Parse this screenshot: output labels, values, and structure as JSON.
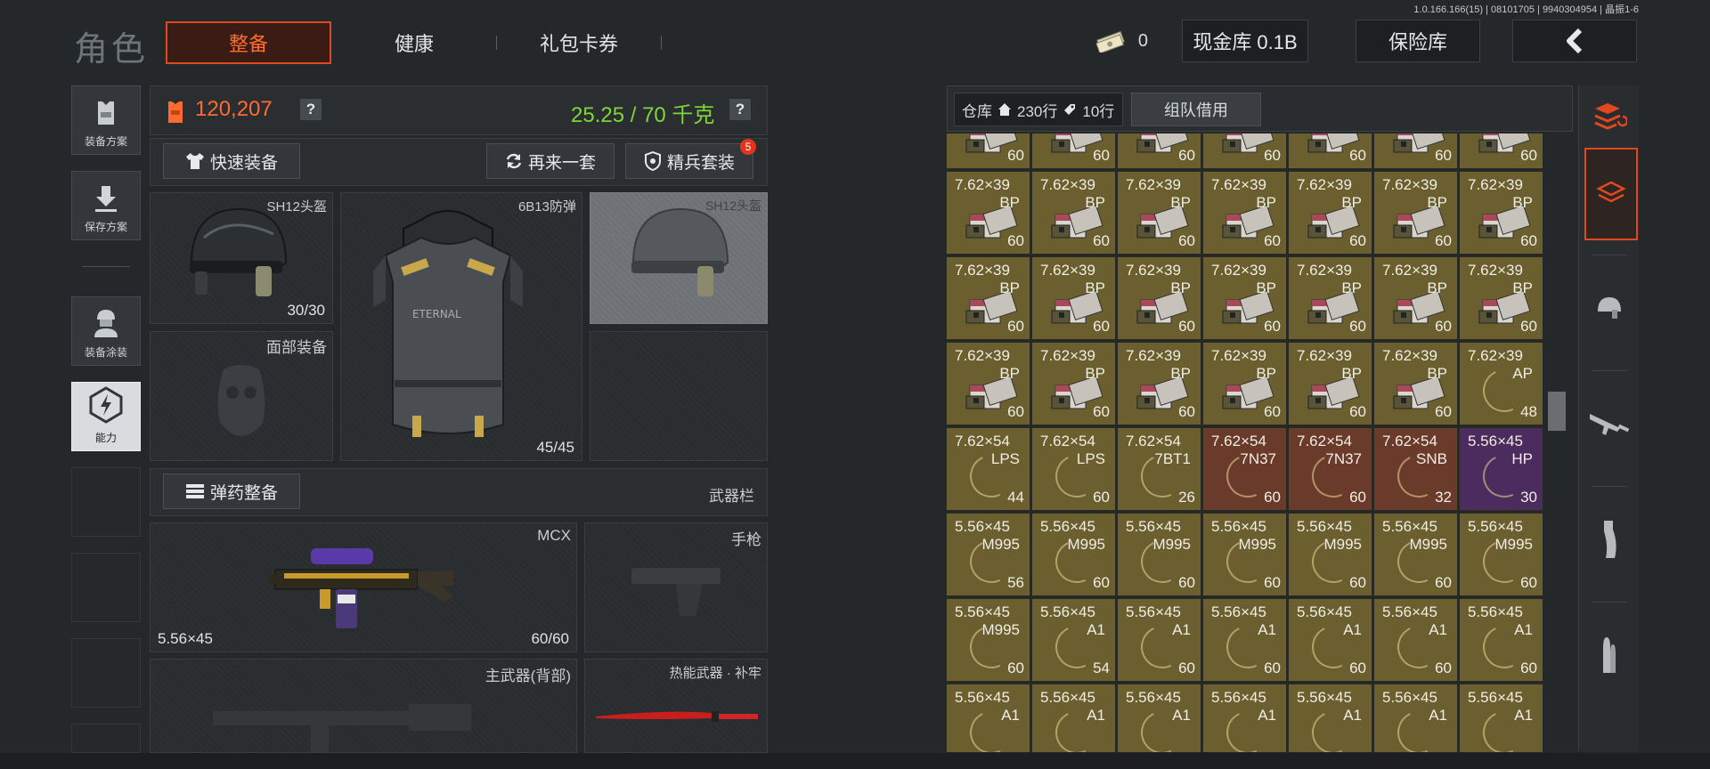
{
  "version": "1.0.166.166(15) | 08101705 | 9940304954 | 晶振1-6",
  "header": {
    "title": "角色",
    "tabs": [
      {
        "label": "整备",
        "active": true
      },
      {
        "label": "健康",
        "active": false
      },
      {
        "label": "礼包卡券",
        "active": false
      }
    ],
    "cash": "0",
    "vault_label": "现金库 0.1B",
    "safe_label": "保险库",
    "accent": "#e0491f"
  },
  "sidebar": {
    "items": [
      {
        "label": "装备方案",
        "icon": "vest-icon"
      },
      {
        "label": "保存方案",
        "icon": "download-icon"
      },
      {
        "label": "装备涂装",
        "icon": "soldier-icon"
      },
      {
        "label": "能力",
        "icon": "lightning-icon"
      }
    ]
  },
  "stats": {
    "value": "120,207",
    "weight": "25.25 / 70 千克",
    "value_color": "#ff6a2f",
    "weight_color": "#7ed63a"
  },
  "actions": {
    "quick_equip": "快速装备",
    "again": "再来一套",
    "elite": "精兵套装",
    "elite_badge": "5"
  },
  "gear": {
    "helmet": {
      "name": "SH12头盔",
      "durability": "30/30"
    },
    "armor": {
      "name": "6B13防弹",
      "durability": "45/45"
    },
    "helmet_alt": {
      "name": "SH12头盔"
    },
    "face": {
      "name": "面部装备"
    }
  },
  "weapons": {
    "ammo_btn": "弹药整备",
    "slot_label": "武器栏",
    "primary": {
      "name": "MCX",
      "caliber": "5.56×45",
      "ammo": "60/60"
    },
    "pistol": {
      "name": "手枪"
    },
    "back": {
      "name": "主武器(背部)"
    },
    "melee": {
      "name": "热能武器 · 补牢"
    }
  },
  "warehouse": {
    "label": "仓库",
    "rows_a": "230行",
    "rows_b": "10行",
    "team_borrow": "组队借用",
    "rows": [
      [
        {
          "cal": "",
          "type": "",
          "count": "60",
          "color": "olive",
          "icon": "ammo-box"
        },
        {
          "cal": "",
          "type": "",
          "count": "60",
          "color": "olive",
          "icon": "ammo-box"
        },
        {
          "cal": "",
          "type": "",
          "count": "60",
          "color": "olive",
          "icon": "ammo-box"
        },
        {
          "cal": "",
          "type": "",
          "count": "60",
          "color": "olive",
          "icon": "ammo-box"
        },
        {
          "cal": "",
          "type": "",
          "count": "60",
          "color": "olive",
          "icon": "ammo-box"
        },
        {
          "cal": "",
          "type": "",
          "count": "60",
          "color": "olive",
          "icon": "ammo-box"
        },
        {
          "cal": "",
          "type": "",
          "count": "60",
          "color": "olive",
          "icon": "ammo-box"
        }
      ],
      [
        {
          "cal": "7.62×39",
          "type": "BP",
          "count": "60",
          "color": "olive",
          "icon": "ammo-box"
        },
        {
          "cal": "7.62×39",
          "type": "BP",
          "count": "60",
          "color": "olive",
          "icon": "ammo-box"
        },
        {
          "cal": "7.62×39",
          "type": "BP",
          "count": "60",
          "color": "olive",
          "icon": "ammo-box"
        },
        {
          "cal": "7.62×39",
          "type": "BP",
          "count": "60",
          "color": "olive",
          "icon": "ammo-box"
        },
        {
          "cal": "7.62×39",
          "type": "BP",
          "count": "60",
          "color": "olive",
          "icon": "ammo-box"
        },
        {
          "cal": "7.62×39",
          "type": "BP",
          "count": "60",
          "color": "olive",
          "icon": "ammo-box"
        },
        {
          "cal": "7.62×39",
          "type": "BP",
          "count": "60",
          "color": "olive",
          "icon": "ammo-box"
        }
      ],
      [
        {
          "cal": "7.62×39",
          "type": "BP",
          "count": "60",
          "color": "olive",
          "icon": "ammo-box"
        },
        {
          "cal": "7.62×39",
          "type": "BP",
          "count": "60",
          "color": "olive",
          "icon": "ammo-box"
        },
        {
          "cal": "7.62×39",
          "type": "BP",
          "count": "60",
          "color": "olive",
          "icon": "ammo-box"
        },
        {
          "cal": "7.62×39",
          "type": "BP",
          "count": "60",
          "color": "olive",
          "icon": "ammo-box"
        },
        {
          "cal": "7.62×39",
          "type": "BP",
          "count": "60",
          "color": "olive",
          "icon": "ammo-box"
        },
        {
          "cal": "7.62×39",
          "type": "BP",
          "count": "60",
          "color": "olive",
          "icon": "ammo-box"
        },
        {
          "cal": "7.62×39",
          "type": "BP",
          "count": "60",
          "color": "olive",
          "icon": "ammo-box"
        }
      ],
      [
        {
          "cal": "7.62×39",
          "type": "BP",
          "count": "60",
          "color": "olive",
          "icon": "ammo-box"
        },
        {
          "cal": "7.62×39",
          "type": "BP",
          "count": "60",
          "color": "olive",
          "icon": "ammo-box"
        },
        {
          "cal": "7.62×39",
          "type": "BP",
          "count": "60",
          "color": "olive",
          "icon": "ammo-box"
        },
        {
          "cal": "7.62×39",
          "type": "BP",
          "count": "60",
          "color": "olive",
          "icon": "ammo-box"
        },
        {
          "cal": "7.62×39",
          "type": "BP",
          "count": "60",
          "color": "olive",
          "icon": "ammo-box"
        },
        {
          "cal": "7.62×39",
          "type": "BP",
          "count": "60",
          "color": "olive",
          "icon": "ammo-box"
        },
        {
          "cal": "7.62×39",
          "type": "AP",
          "count": "48",
          "color": "olive",
          "icon": "ring"
        }
      ],
      [
        {
          "cal": "7.62×54",
          "type": "LPS",
          "count": "44",
          "color": "olive",
          "icon": "ring"
        },
        {
          "cal": "7.62×54",
          "type": "LPS",
          "count": "60",
          "color": "olive",
          "icon": "ring"
        },
        {
          "cal": "7.62×54",
          "type": "7BT1",
          "count": "26",
          "color": "olive",
          "icon": "ring"
        },
        {
          "cal": "7.62×54",
          "type": "7N37",
          "count": "60",
          "color": "red",
          "icon": "ring"
        },
        {
          "cal": "7.62×54",
          "type": "7N37",
          "count": "60",
          "color": "red",
          "icon": "ring"
        },
        {
          "cal": "7.62×54",
          "type": "SNB",
          "count": "32",
          "color": "red",
          "icon": "ring"
        },
        {
          "cal": "5.56×45",
          "type": "HP",
          "count": "30",
          "color": "purple",
          "icon": "ring"
        }
      ],
      [
        {
          "cal": "5.56×45",
          "type": "M995",
          "count": "56",
          "color": "olive",
          "icon": "ring"
        },
        {
          "cal": "5.56×45",
          "type": "M995",
          "count": "60",
          "color": "olive",
          "icon": "ring"
        },
        {
          "cal": "5.56×45",
          "type": "M995",
          "count": "60",
          "color": "olive",
          "icon": "ring"
        },
        {
          "cal": "5.56×45",
          "type": "M995",
          "count": "60",
          "color": "olive",
          "icon": "ring"
        },
        {
          "cal": "5.56×45",
          "type": "M995",
          "count": "60",
          "color": "olive",
          "icon": "ring"
        },
        {
          "cal": "5.56×45",
          "type": "M995",
          "count": "60",
          "color": "olive",
          "icon": "ring"
        },
        {
          "cal": "5.56×45",
          "type": "M995",
          "count": "60",
          "color": "olive",
          "icon": "ring"
        }
      ],
      [
        {
          "cal": "5.56×45",
          "type": "M995",
          "count": "60",
          "color": "olive",
          "icon": "ring"
        },
        {
          "cal": "5.56×45",
          "type": "A1",
          "count": "54",
          "color": "olive",
          "icon": "ring"
        },
        {
          "cal": "5.56×45",
          "type": "A1",
          "count": "60",
          "color": "olive",
          "icon": "ring"
        },
        {
          "cal": "5.56×45",
          "type": "A1",
          "count": "60",
          "color": "olive",
          "icon": "ring"
        },
        {
          "cal": "5.56×45",
          "type": "A1",
          "count": "60",
          "color": "olive",
          "icon": "ring"
        },
        {
          "cal": "5.56×45",
          "type": "A1",
          "count": "60",
          "color": "olive",
          "icon": "ring"
        },
        {
          "cal": "5.56×45",
          "type": "A1",
          "count": "60",
          "color": "olive",
          "icon": "ring"
        }
      ],
      [
        {
          "cal": "5.56×45",
          "type": "A1",
          "count": "",
          "color": "olive",
          "icon": "ring"
        },
        {
          "cal": "5.56×45",
          "type": "A1",
          "count": "",
          "color": "olive",
          "icon": "ring"
        },
        {
          "cal": "5.56×45",
          "type": "A1",
          "count": "",
          "color": "olive",
          "icon": "ring"
        },
        {
          "cal": "5.56×45",
          "type": "A1",
          "count": "",
          "color": "olive",
          "icon": "ring"
        },
        {
          "cal": "5.56×45",
          "type": "A1",
          "count": "",
          "color": "olive",
          "icon": "ring"
        },
        {
          "cal": "5.56×45",
          "type": "A1",
          "count": "",
          "color": "olive",
          "icon": "ring"
        },
        {
          "cal": "5.56×45",
          "type": "A1",
          "count": "",
          "color": "olive",
          "icon": "ring"
        }
      ]
    ]
  },
  "right_bar": {
    "icons": [
      "sort-stack-icon",
      "stack-layers-icon",
      "helmet-icon",
      "rifle-icon",
      "magazine-icon",
      "bullet-icon"
    ]
  }
}
